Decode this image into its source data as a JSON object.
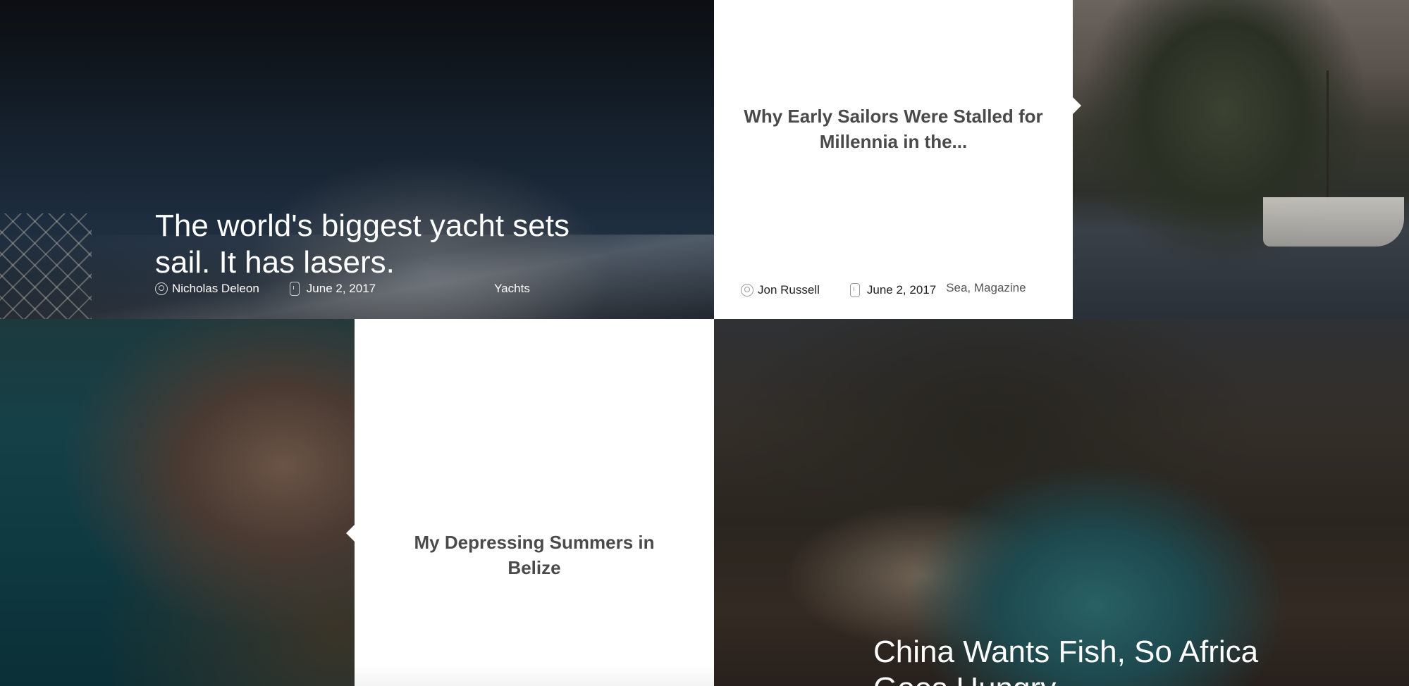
{
  "posts": [
    {
      "title": "The world's biggest yacht sets sail. It has lasers.",
      "author": "Nicholas Deleon",
      "date": "June 2, 2017",
      "category": "Yachts"
    },
    {
      "title": "Why Early Sailors Were Stalled for Millennia in the...",
      "author": "Jon Russell",
      "date": "June 2, 2017",
      "categories": "Sea, Magazine"
    },
    {
      "title": "My Depressing Summers in Belize"
    },
    {
      "title": "China Wants Fish, So Africa Goes Hungry"
    }
  ],
  "icons": {
    "author": "user-icon",
    "date": "watch-icon"
  }
}
